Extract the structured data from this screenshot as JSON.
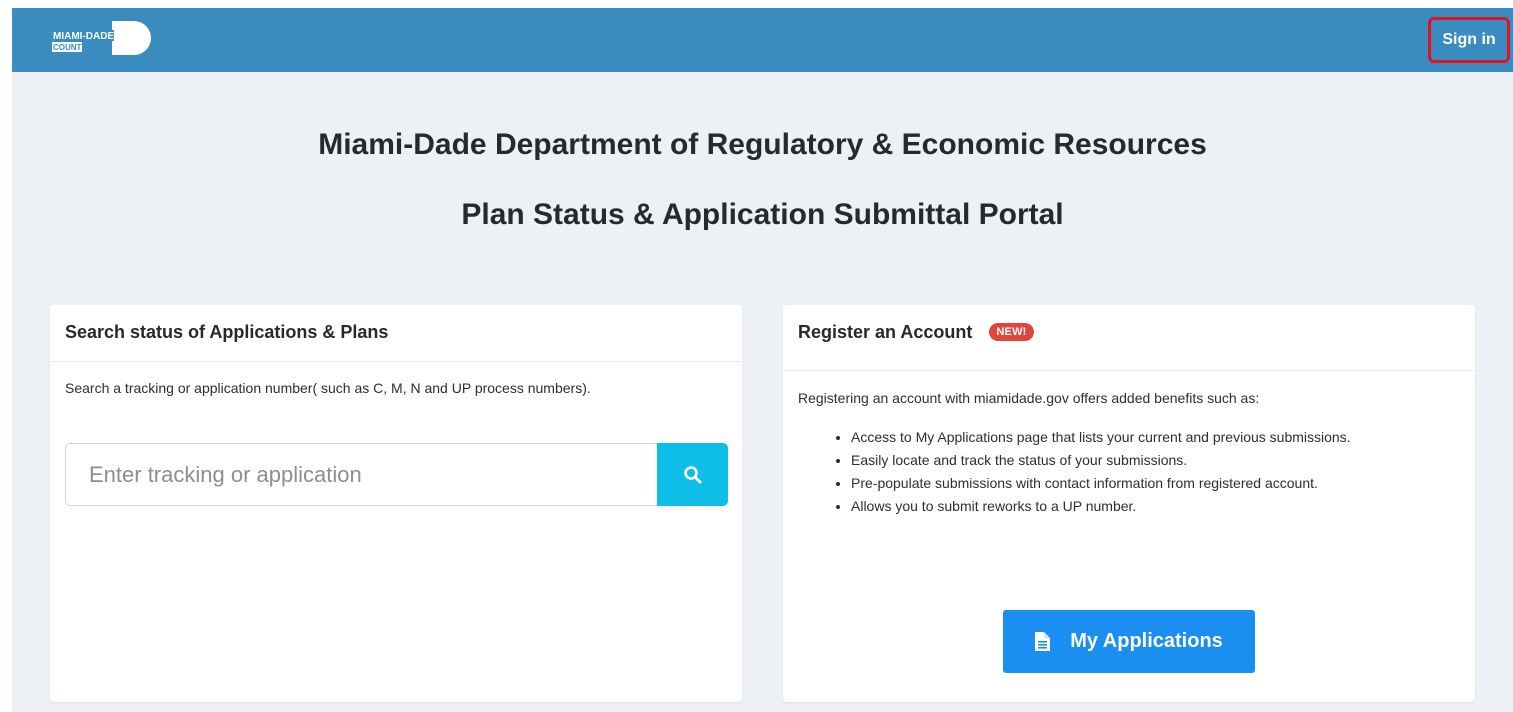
{
  "header": {
    "logo_line1": "MIAMI-DADE",
    "logo_line2": "COUNTY",
    "signin_label": "Sign in",
    "bg_color": "#3a8bbf",
    "highlight_color": "#e3131b"
  },
  "page": {
    "title_line1": "Miami-Dade Department of Regulatory & Economic Resources",
    "title_line2": "Plan Status & Application Submittal Portal"
  },
  "search_card": {
    "title": "Search status of Applications & Plans",
    "description": "Search a tracking or application number( such as C, M, N and UP process numbers).",
    "input_placeholder": "Enter tracking or application",
    "input_value": "",
    "search_icon": "search-icon",
    "button_color": "#0fbee8"
  },
  "register_card": {
    "title": "Register an Account",
    "badge": "NEW!",
    "intro": "Registering an account with miamidade.gov offers added benefits such as:",
    "benefits": [
      "Access to My Applications page that lists your current and previous submissions.",
      "Easily locate and track the status of your submissions.",
      "Pre-populate submissions with contact information from registered account.",
      "Allows you to submit reworks to a UP number."
    ],
    "button_label": "My Applications",
    "button_icon": "document-icon",
    "button_color": "#1a8ff0"
  }
}
